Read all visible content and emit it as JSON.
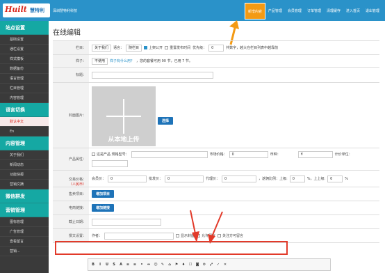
{
  "header": {
    "logo_mark": "Huilt",
    "logo_text": "慧特利",
    "company": "深圳慧特利科技",
    "nav": [
      "新增内容",
      "产品管理",
      "会员管理",
      "订单管理",
      "清理缓存",
      "进入首页",
      "退出管理"
    ]
  },
  "sidebar": {
    "sections": [
      {
        "title": "站点设置",
        "items": [
          "基础设置",
          "通栏设置",
          "样式模板",
          "数据备份",
          "语言管理",
          "栏目管理",
          "内容管理"
        ]
      },
      {
        "title": "语言切换",
        "items": [
          "默认中文",
          "En"
        ],
        "selected": 0
      },
      {
        "title": "内容管理",
        "items": [
          "关于我们",
          "新闻动态",
          "功能快报",
          "营销文摘"
        ]
      },
      {
        "title": "微信群发",
        "items": []
      },
      {
        "title": "营销管理",
        "items": [
          "图标管理",
          "广告管理",
          "查看留言",
          "营销..."
        ]
      }
    ]
  },
  "page": {
    "title": "在线编辑"
  },
  "form": {
    "column": {
      "label": "栏目：",
      "select1": "关于我们",
      "lang_label": "语言：",
      "select2": "随栏目",
      "publish": "上架公开",
      "reset_time": "重置发布时间",
      "priority_label": "优先级：",
      "priority_value": "0",
      "note": "共数字，越大在栏目列表中越靠前"
    },
    "template": {
      "label": "样子：",
      "select": "不使用",
      "help": "样子有什么用？",
      "info": "，您的套餐可用 90 节，已用 7 节。"
    },
    "title_row": {
      "label": "标题："
    },
    "cover": {
      "label": "封面图片：",
      "upload_text": "从本地上传",
      "select_button": "选择"
    },
    "product": {
      "label": "产品属性：",
      "checkbox": "这是产品 规格型号：",
      "market_price": "市场价格：",
      "market_value": "0",
      "currency": "币种：",
      "unit_value": "¥",
      "unit_label": "计价单位："
    },
    "trade": {
      "label": "交易价格：",
      "sub": "（人民币）",
      "member_price": "会员价：",
      "member_value": "0",
      "wholesale": "批发价：",
      "wholesale_value": "0",
      "agent": "代理价：",
      "agent_value": "0",
      "ratio": "，返佣比例：上级:",
      "ratio1": "0",
      "pct1": "%，上上级:",
      "ratio2": "0",
      "pct2": "%"
    },
    "sell": {
      "label": "售卖项目：",
      "button": "增加项目"
    },
    "ecommerce": {
      "label": "电商链接：",
      "button": "增加链接"
    },
    "deadline": {
      "label": "截止日期："
    },
    "post": {
      "label": "撰文设置：",
      "author": "作者：",
      "show_cover": "显示封面",
      "allow_comment": "允许留言",
      "follow_comment": "关注方可留言"
    }
  },
  "editor": {
    "buttons": [
      "B",
      "I",
      "U",
      "S",
      "A",
      "≡",
      "≡",
      "•",
      "⇔",
      "☺",
      "✎",
      "⌂",
      "⚑",
      "♦",
      "☐",
      "◙",
      "⚙",
      "⤢",
      "✓",
      "✕"
    ]
  }
}
